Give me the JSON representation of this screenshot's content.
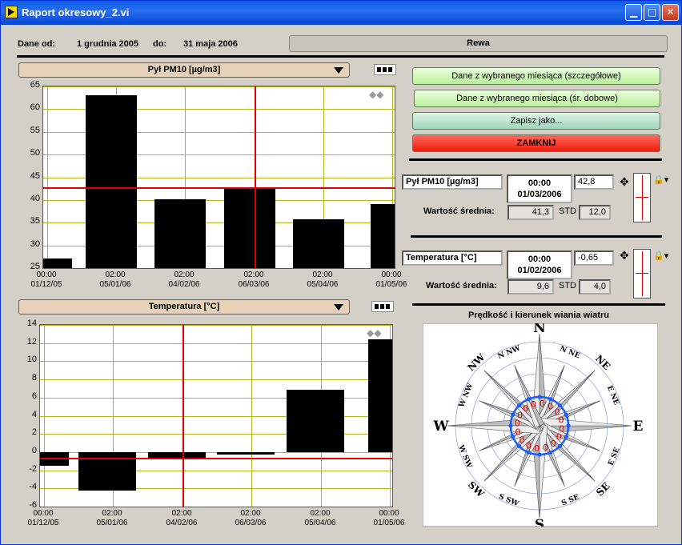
{
  "window": {
    "title": "Raport okresowy_2.vi"
  },
  "header": {
    "from_label": "Dane od:",
    "from_value": "1 grudnia 2005",
    "to_label": "do:",
    "to_value": "31 maja 2006",
    "station": "Rewa"
  },
  "chart_data": [
    {
      "type": "bar",
      "selector": "Pył PM10 [µg/m3]",
      "x_tick_labels": [
        [
          "00:00",
          "01/12/05"
        ],
        [
          "02:00",
          "05/01/06"
        ],
        [
          "02:00",
          "04/02/06"
        ],
        [
          "02:00",
          "06/03/06"
        ],
        [
          "02:00",
          "05/04/06"
        ],
        [
          "00:00",
          "01/05/06"
        ]
      ],
      "ylim": [
        25,
        65
      ],
      "y_ticks": [
        25,
        30,
        35,
        40,
        45,
        50,
        55,
        60,
        65
      ],
      "categories": [
        "Dec 2005",
        "Jan 2006",
        "Feb 2006",
        "Mar 2006",
        "Apr 2006",
        "May 2006"
      ],
      "values": [
        27.2,
        63.1,
        40.1,
        42.8,
        35.8,
        39.1
      ],
      "cursor": {
        "category_index": 3,
        "value": 42.8
      },
      "grid": true,
      "colors": {
        "bar": "#000000",
        "grid": "#b5b521",
        "cursor": "#e00000"
      }
    },
    {
      "type": "bar",
      "selector": "Temperatura [°C]",
      "x_tick_labels": [
        [
          "00:00",
          "01/12/05"
        ],
        [
          "02:00",
          "05/01/06"
        ],
        [
          "02:00",
          "04/02/06"
        ],
        [
          "02:00",
          "06/03/06"
        ],
        [
          "02:00",
          "05/04/06"
        ],
        [
          "00:00",
          "01/05/06"
        ]
      ],
      "ylim": [
        -6,
        14
      ],
      "y_ticks": [
        -6,
        -4,
        -2,
        0,
        2,
        4,
        6,
        8,
        10,
        12,
        14
      ],
      "categories": [
        "Dec 2005",
        "Jan 2006",
        "Feb 2006",
        "Mar 2006",
        "Apr 2006",
        "May 2006"
      ],
      "values": [
        -1.5,
        -4.2,
        -0.65,
        -0.3,
        6.9,
        12.4
      ],
      "cursor": {
        "category_index": 2,
        "value": -0.65
      },
      "grid": true,
      "colors": {
        "bar": "#000000",
        "grid": "#b5b521",
        "cursor": "#e00000"
      }
    }
  ],
  "buttons": {
    "detailed": "Dane z wybranego miesiąca (szczegółowe)",
    "daily": "Dane z wybranego miesiąca (śr. dobowe)",
    "save": "Zapisz jako...",
    "close": "ZAMKNIJ"
  },
  "pm10_panel": {
    "name": "Pył PM10 [µg/m3]",
    "time": "00:00",
    "date": "01/03/2006",
    "value": "42,8",
    "mean_label": "Wartość średnia:",
    "mean": "41,3",
    "std_label": "STD",
    "std": "12,0"
  },
  "temp_panel": {
    "name": "Temperatura [°C]",
    "time": "00:00",
    "date": "01/02/2006",
    "value": "-0,65",
    "mean_label": "Wartość średnia:",
    "mean": "9,6",
    "std_label": "STD",
    "std": "4,0"
  },
  "wind": {
    "title": "Prędkość i kierunek wiania wiatru",
    "directions": [
      "N",
      "N NE",
      "NE",
      "E NE",
      "E",
      "E SE",
      "SE",
      "S SE",
      "S",
      "S SW",
      "SW",
      "W SW",
      "W",
      "W NW",
      "NW",
      "N NW"
    ],
    "speeds": [
      0,
      0,
      0,
      0,
      0,
      0,
      0,
      0,
      0,
      0,
      0,
      0,
      0,
      0,
      0,
      0
    ]
  }
}
